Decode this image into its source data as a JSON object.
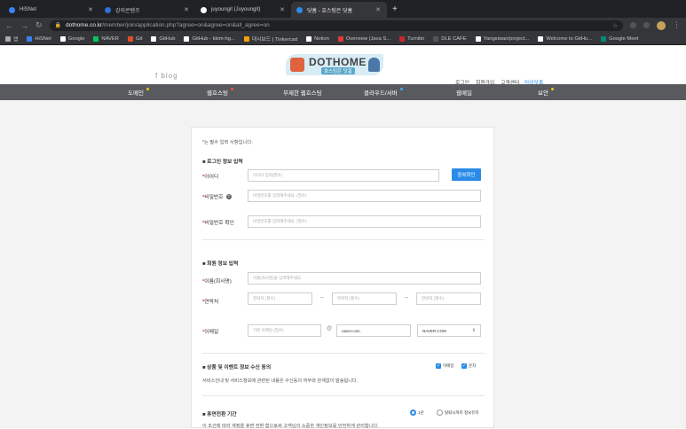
{
  "browser": {
    "tabs": [
      {
        "label": "HiSNet",
        "color": "#3b82f6"
      },
      {
        "label": "강의콘텐츠",
        "color": "#2f6fd6"
      },
      {
        "label": "juyoungit (Juyoungit)",
        "color": "#ffffff"
      },
      {
        "label": "닷홈 - 호스팅은 닷홈",
        "color": "#2a8be8"
      }
    ],
    "new_tab": "+",
    "url_domain": "dothome.co.kr",
    "url_path": "/member/join/application.php?agree=on&agree=on&all_agree=on",
    "bookmarks": [
      {
        "label": "앱",
        "color": "#aaaaaa"
      },
      {
        "label": "HiSNet",
        "color": "#3b82f6"
      },
      {
        "label": "Google",
        "color": "#ffffff"
      },
      {
        "label": "NAVER",
        "color": "#03c75a"
      },
      {
        "label": "Git",
        "color": "#e44d26"
      },
      {
        "label": "GitHub",
        "color": "#ffffff"
      },
      {
        "label": "GitHub - kkim-hg...",
        "color": "#ffffff"
      },
      {
        "label": "대시보드 | Tinkercad",
        "color": "#f4a300"
      },
      {
        "label": "Notion",
        "color": "#ffffff"
      },
      {
        "label": "Overview (Java S...",
        "color": "#e53935"
      },
      {
        "label": "Turnitin",
        "color": "#c62828"
      },
      {
        "label": "DLE CAFE",
        "color": "#555555"
      },
      {
        "label": "Yangsiwan/project...",
        "color": "#ffffff"
      },
      {
        "label": "Welcome to GitHu...",
        "color": "#ffffff"
      },
      {
        "label": "Google Meet",
        "color": "#00897b"
      }
    ]
  },
  "header": {
    "blog": "f blog",
    "logo_text": "DOTHOME",
    "logo_sub": "호스팅은 닷홈",
    "links": [
      "로그인",
      "회원가입",
      "고객센터",
      "마이닷홈"
    ]
  },
  "gnb": [
    {
      "label": "도메인",
      "dot": "#f5c518"
    },
    {
      "label": "웹호스팅",
      "dot": "#ff4d4d"
    },
    {
      "label": "무제한 웹호스팅",
      "dot": ""
    },
    {
      "label": "클라우드/서버",
      "dot": "#3ab0ff"
    },
    {
      "label": "웹메일",
      "dot": ""
    },
    {
      "label": "보안",
      "dot": "#f5c518"
    }
  ],
  "form": {
    "required_note": "*는 필수 입력 사항입니다.",
    "login_section": "■ 로그인 정보 입력",
    "id_label": "아이디",
    "id_placeholder": "아이디 입력(필수)",
    "id_check": "중복확인",
    "pw_label": "비밀번호",
    "pw_placeholder": "비밀번호를 입력해주세요. (필수)",
    "pw2_label": "비밀번호 확인",
    "pw2_placeholder": "비밀번호를 입력해주세요. (필수)",
    "member_section": "■ 회원 정보 입력",
    "name_label": "이름(회사명)",
    "name_placeholder": "이름(회사명)을 입력해주세요.",
    "phone_label": "연락처",
    "phone_placeholder": "연락처 (필수)",
    "email_label": "이메일",
    "email_placeholder": "기본 이메일 (필수)",
    "email_domain": "naver.com",
    "email_select": "NAVER.COM",
    "marketing_section": "■ 상품 및 이벤트 정보 수신 동의",
    "marketing_email": "이메일",
    "marketing_sms": "문자",
    "marketing_desc": "서비스안내 및 서비스정보에 관련된 내용은 수신동의 여부와 관계없이 발송됩니다.",
    "dormant_section": "■ 휴면전환 기간",
    "dormant_opt1": "1년",
    "dormant_opt2": "탈퇴시까지 정보유지",
    "dormant_desc": "이 조건에 따라 계정을 휴면 전환 함으로써 고객님의 소중한 개인정보를 안전하게 관리합니다."
  }
}
